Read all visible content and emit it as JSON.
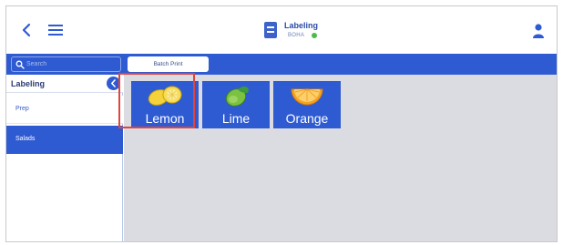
{
  "header": {
    "app_title": "Labeling",
    "app_subtitle": "BOHA",
    "status_color": "#4cbb4c"
  },
  "toolbar": {
    "search_placeholder": "Search",
    "batch_print_label": "Batch Print"
  },
  "sidebar": {
    "title": "Labeling",
    "items": [
      {
        "label": "Prep",
        "selected": false
      },
      {
        "label": "Salads",
        "selected": true
      }
    ]
  },
  "main": {
    "tiles": [
      {
        "label": "Lemon",
        "icon": "lemon-icon",
        "selected": true
      },
      {
        "label": "Lime",
        "icon": "lime-icon",
        "selected": false
      },
      {
        "label": "Orange",
        "icon": "orange-icon",
        "selected": false
      }
    ]
  },
  "colors": {
    "accent": "#2f5bd2",
    "selection_outline": "#e0443e"
  }
}
